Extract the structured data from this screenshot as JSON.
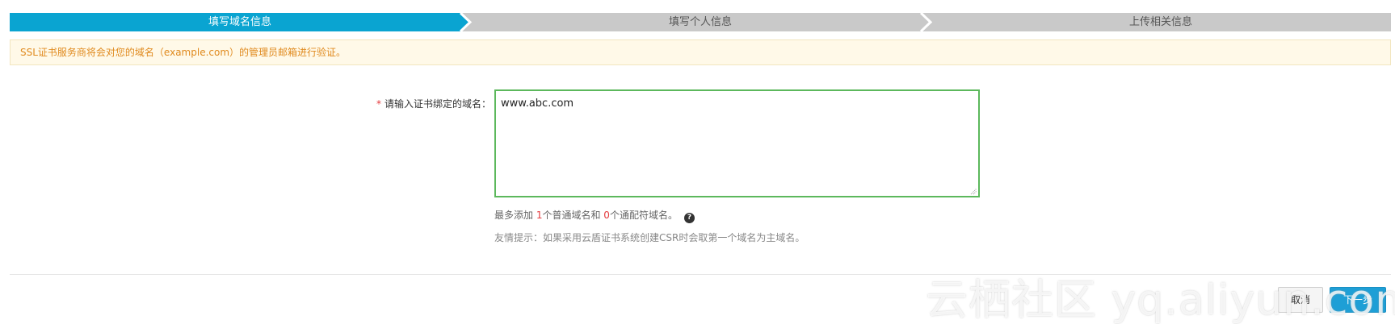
{
  "steps": [
    {
      "label": "填写域名信息",
      "state": "active"
    },
    {
      "label": "填写个人信息",
      "state": "inactive"
    },
    {
      "label": "上传相关信息",
      "state": "inactive"
    }
  ],
  "colors": {
    "step_active": "#0aa4d1",
    "step_inactive": "#c9c9c9",
    "input_border": "#5cb85c",
    "next_button": "#1e9fd6"
  },
  "notice": {
    "text": "SSL证书服务商将会对您的域名（example.com）的管理员邮箱进行验证。"
  },
  "form": {
    "required_mark": "*",
    "domain_label": "请输入证书绑定的域名：",
    "domain_value": "www.abc.com"
  },
  "hint": {
    "prefix": "最多添加 ",
    "normal_count": "1",
    "mid": "个普通域名和 ",
    "wildcard_count": "0",
    "suffix": "个通配符域名。",
    "help_icon": "question-circle-icon",
    "help_glyph": "?"
  },
  "tip": {
    "text": "友情提示：如果采用云盾证书系统创建CSR时会取第一个域名为主域名。"
  },
  "buttons": {
    "cancel": "取消",
    "next": "下一步"
  },
  "watermark": {
    "text": "云栖社区 yq.aliyun.com"
  }
}
